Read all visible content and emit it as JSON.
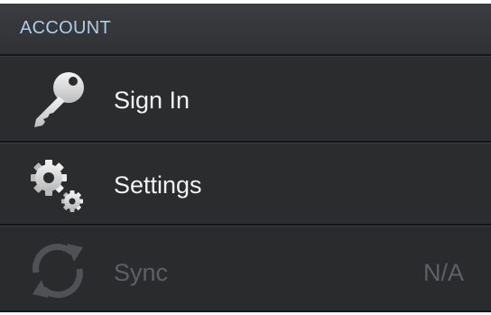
{
  "section": {
    "title": "ACCOUNT"
  },
  "items": [
    {
      "label": "Sign In",
      "icon": "key-icon",
      "enabled": true
    },
    {
      "label": "Settings",
      "icon": "gears-icon",
      "enabled": true
    },
    {
      "label": "Sync",
      "value": "N/A",
      "icon": "sync-icon",
      "enabled": false
    }
  ],
  "colors": {
    "header_text": "#aecde8",
    "label_text": "#f2f2f2",
    "disabled_text": "#5e6064",
    "background": "#2b2c2e"
  }
}
